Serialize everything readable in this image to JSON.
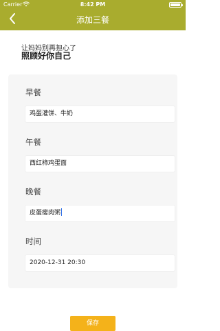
{
  "status_bar": {
    "carrier": "Carrier",
    "time": "8:42 PM",
    "battery_level": 0.85
  },
  "nav": {
    "back_icon": "chevron-left-icon",
    "title": "添加三餐"
  },
  "header": {
    "subtitle": "让妈妈别再担心了",
    "heading": "照顾好你自己"
  },
  "form": {
    "breakfast": {
      "label": "早餐",
      "value": "鸡蛋灌饼、牛奶"
    },
    "lunch": {
      "label": "午餐",
      "value": "西红柿鸡蛋面"
    },
    "dinner": {
      "label": "晚餐",
      "value": "皮蛋瘦肉粥"
    },
    "time": {
      "label": "时间",
      "value": "2020-12-31  20:30"
    }
  },
  "actions": {
    "save_label": "保存"
  },
  "colors": {
    "nav_bar": "#a9ac2e",
    "save_button": "#f4b21a",
    "card_bg": "#f6f6f6",
    "caret": "#2f6fe8"
  }
}
